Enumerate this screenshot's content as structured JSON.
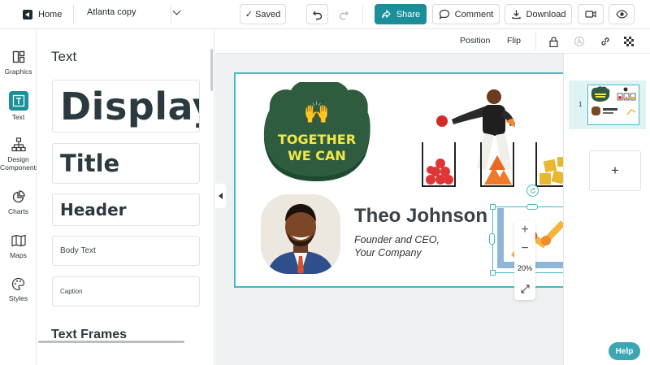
{
  "topbar": {
    "home_label": "Home",
    "document_name": "Atlanta copy",
    "saved_label": "Saved",
    "share_label": "Share",
    "comment_label": "Comment",
    "download_label": "Download"
  },
  "rail": [
    {
      "label": "Graphics",
      "icon": "graphics-icon"
    },
    {
      "label": "Text",
      "icon": "text-icon"
    },
    {
      "label": "Design Components",
      "icon": "design-components-icon"
    },
    {
      "label": "Charts",
      "icon": "charts-icon"
    },
    {
      "label": "Maps",
      "icon": "maps-icon"
    },
    {
      "label": "Styles",
      "icon": "styles-icon"
    }
  ],
  "panel": {
    "title": "Text",
    "cards": {
      "display": "Display",
      "title": "Title",
      "header": "Header",
      "body": "Body Text",
      "caption": "Caption"
    },
    "section_next": "Text Frames"
  },
  "toolbar2": {
    "position_label": "Position",
    "flip_label": "Flip"
  },
  "slide": {
    "badge_line1": "TOGETHER",
    "badge_line2": "WE CAN",
    "badge_emoji": "🙌",
    "name": "Theo Johnson",
    "role_line1": "Founder and CEO,",
    "role_line2": "Your Company"
  },
  "zoom": {
    "in": "+",
    "out": "−",
    "level": "20%"
  },
  "pages": {
    "page_number": "1",
    "add_label": "+"
  },
  "help_label": "Help",
  "colors": {
    "accent": "#1a8f9a",
    "badge_green": "#2f5c3f",
    "badge_text": "#f2e84a",
    "selection": "#4ab8c0"
  }
}
